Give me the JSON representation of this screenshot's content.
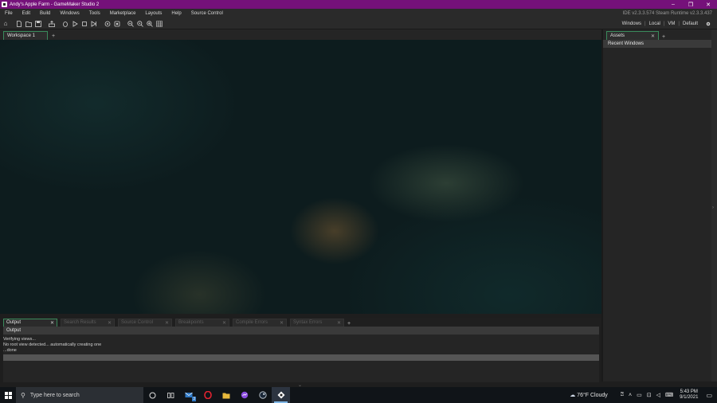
{
  "titlebar": {
    "title": "Andy's Apple Farm - GameMaker Studio 2",
    "minimize": "–",
    "maximize": "❐",
    "close": "✕"
  },
  "menu": {
    "items": [
      "File",
      "Edit",
      "Build",
      "Windows",
      "Tools",
      "Marketplace",
      "Layouts",
      "Help",
      "Source Control"
    ],
    "version_info": "IDE v2.3.3.574 Steam  Runtime v2.3.3.437"
  },
  "toolbar": {
    "icons": [
      "home-icon",
      "new-file-icon",
      "open-folder-icon",
      "save-icon",
      "export-icon",
      "debug-icon",
      "run-icon",
      "stop-icon",
      "clean-icon",
      "target-icon",
      "settings-icon",
      "zoom-out-icon",
      "zoom-reset-icon",
      "zoom-in-icon",
      "grid-icon"
    ],
    "targets": {
      "platform": "Windows",
      "location": "Local",
      "runtime": "VM",
      "config": "Default"
    }
  },
  "workspace": {
    "tab_label": "Workspace 1",
    "add_label": "+"
  },
  "assets": {
    "tab_label": "Assets",
    "close": "✕",
    "add_label": "+",
    "recent_windows": "Recent Windows"
  },
  "output": {
    "tabs": [
      {
        "label": "Output",
        "active": true
      },
      {
        "label": "Search Results",
        "active": false
      },
      {
        "label": "Source Control",
        "active": false
      },
      {
        "label": "Breakpoints",
        "active": false
      },
      {
        "label": "Compile Errors",
        "active": false
      },
      {
        "label": "Syntax Errors",
        "active": false
      }
    ],
    "add_label": "+",
    "header": "Output",
    "lines": [
      "Verifying views...",
      "No root view detected... automatically creating one",
      "...done"
    ]
  },
  "taskbar": {
    "search_placeholder": "Type here to search",
    "weather": "76°F  Cloudy",
    "time": "5:43 PM",
    "date": "9/1/2021",
    "apps": [
      "cortana-icon",
      "task-view-icon",
      "mail-icon",
      "opera-icon",
      "file-explorer-icon",
      "messenger-icon",
      "steam-icon",
      "gamemaker-icon"
    ],
    "mail_badge": "3"
  }
}
